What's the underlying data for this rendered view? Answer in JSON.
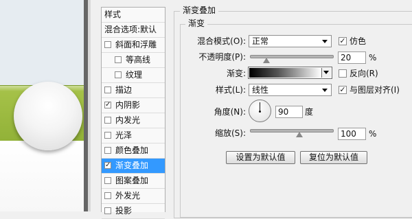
{
  "style_list": {
    "header": "样式",
    "blend_options": "混合选项:默认",
    "items": [
      {
        "label": "斜面和浮雕",
        "checked": false
      },
      {
        "label": "等高线",
        "checked": false
      },
      {
        "label": "纹理",
        "checked": false
      },
      {
        "label": "描边",
        "checked": false
      },
      {
        "label": "内阴影",
        "checked": true
      },
      {
        "label": "内发光",
        "checked": false
      },
      {
        "label": "光泽",
        "checked": false
      },
      {
        "label": "颜色叠加",
        "checked": false
      },
      {
        "label": "渐变叠加",
        "checked": true
      },
      {
        "label": "图案叠加",
        "checked": false
      },
      {
        "label": "外发光",
        "checked": false
      },
      {
        "label": "投影",
        "checked": false
      }
    ]
  },
  "panel": {
    "title": "渐变叠加",
    "subtitle": "渐变",
    "blend_mode": {
      "label": "混合模式(O):",
      "value": "正常"
    },
    "dither": {
      "label": "仿色",
      "checked": true
    },
    "opacity": {
      "label": "不透明度(P):",
      "value": "20",
      "unit": "%",
      "fraction": 0.2
    },
    "gradient": {
      "label": "渐变:"
    },
    "reverse": {
      "label": "反向(R)",
      "checked": false
    },
    "style": {
      "label": "样式(L):",
      "value": "线性"
    },
    "align_layer": {
      "label": "与图层对齐(I)",
      "checked": true
    },
    "angle": {
      "label": "角度(N):",
      "value": "90",
      "unit": "度"
    },
    "scale": {
      "label": "缩放(S):",
      "value": "100",
      "unit": "%",
      "fraction": 0.6
    },
    "buttons": {
      "make_default": "设置为默认值",
      "reset_default": "复位为默认值"
    }
  },
  "colors": {
    "selection": "#3399ff",
    "preview_green": "#a7c34a"
  },
  "icons": {
    "check": "✓"
  }
}
